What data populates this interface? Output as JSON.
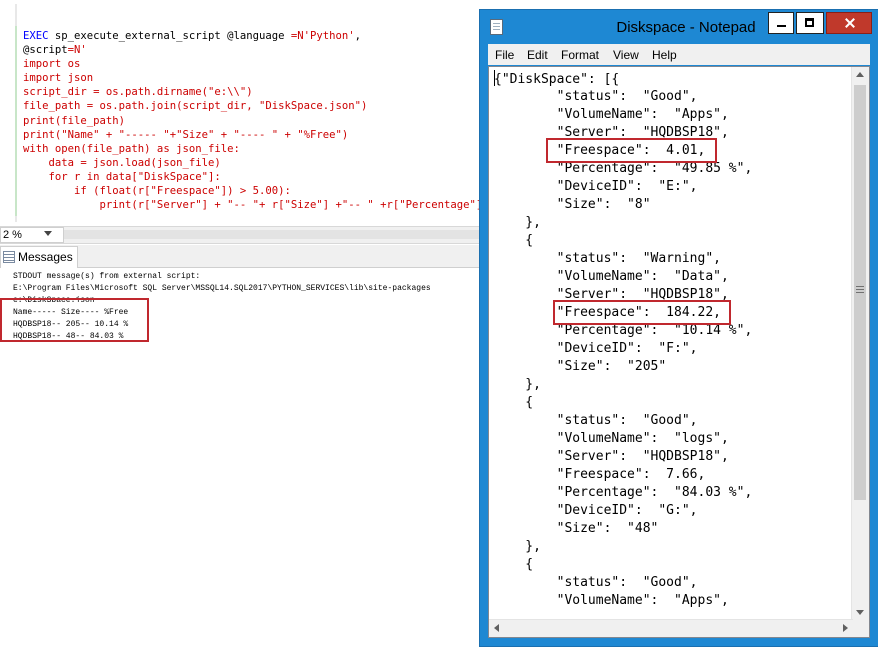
{
  "editor": {
    "code_lines": [
      [
        {
          "t": "EXEC",
          "c": "kw"
        },
        {
          "t": " sp_execute_external_script @language ",
          "c": "pl"
        },
        {
          "t": "=N'Python'",
          "c": "str"
        },
        {
          "t": ",",
          "c": "pl"
        }
      ],
      [
        {
          "t": "@script",
          "c": "pl"
        },
        {
          "t": "=N'",
          "c": "str"
        }
      ],
      [
        {
          "t": "import os",
          "c": "str"
        }
      ],
      [
        {
          "t": "import json",
          "c": "str"
        }
      ],
      [
        {
          "t": "script_dir = os.path.dirname(\"e:\\\\\")",
          "c": "str"
        }
      ],
      [
        {
          "t": "file_path = os.path.join(script_dir, \"DiskSpace.json\")",
          "c": "str"
        }
      ],
      [
        {
          "t": "print(file_path)",
          "c": "str"
        }
      ],
      [
        {
          "t": "print(\"Name\" + \"----- \"+\"Size\" + \"---- \" + \"%Free\")",
          "c": "str"
        }
      ],
      [
        {
          "t": "with open(file_path) as json_file:",
          "c": "str"
        }
      ],
      [
        {
          "t": "    data = json.load(json_file)",
          "c": "str"
        }
      ],
      [
        {
          "t": "    for r in data[\"DiskSpace\"]:",
          "c": "str"
        }
      ],
      [
        {
          "t": "        if (float(r[\"Freespace\"]) > 5.00):",
          "c": "str"
        }
      ],
      [
        {
          "t": "            print(r[\"Server\"] + \"-- \"+ r[\"Size\"] +\"-- \" +r[\"Percentage\"])'",
          "c": "str"
        }
      ]
    ],
    "zoom": "2 %"
  },
  "messages": {
    "tab_label": "Messages",
    "lines": [
      "STDOUT message(s) from external script:",
      "E:\\Program Files\\Microsoft SQL Server\\MSSQL14.SQL2017\\PYTHON_SERVICES\\lib\\site-packages",
      "e:\\DiskSpace.json",
      "Name----- Size---- %Free",
      "HQDBSP18-- 205-- 10.14 %",
      "HQDBSP18-- 48-- 84.03 %"
    ]
  },
  "notepad": {
    "title": "Diskspace - Notepad",
    "menu": [
      "File",
      "Edit",
      "Format",
      "View",
      "Help"
    ],
    "lines": [
      "{\"DiskSpace\": [{",
      "        \"status\":  \"Good\",",
      "        \"VolumeName\":  \"Apps\",",
      "        \"Server\":  \"HQDBSP18\",",
      "        \"Freespace\":  4.01,",
      "        \"Percentage\":  \"49.85 %\",",
      "        \"DeviceID\":  \"E:\",",
      "        \"Size\":  \"8\"",
      "    },",
      "    {",
      "        \"status\":  \"Warning\",",
      "        \"VolumeName\":  \"Data\",",
      "        \"Server\":  \"HQDBSP18\",",
      "        \"Freespace\":  184.22,",
      "        \"Percentage\":  \"10.14 %\",",
      "        \"DeviceID\":  \"F:\",",
      "        \"Size\":  \"205\"",
      "    },",
      "    {",
      "        \"status\":  \"Good\",",
      "        \"VolumeName\":  \"logs\",",
      "        \"Server\":  \"HQDBSP18\",",
      "        \"Freespace\":  7.66,",
      "        \"Percentage\":  \"84.03 %\",",
      "        \"DeviceID\":  \"G:\",",
      "        \"Size\":  \"48\"",
      "    },",
      "    {",
      "        \"status\":  \"Good\",",
      "        \"VolumeName\":  \"Apps\","
    ]
  },
  "colors": {
    "highlight_box": "#c0282e",
    "keyword": "#0000ff",
    "string": "#cc0000",
    "notepad_frame": "#1e88d3",
    "close_button": "#c0392b"
  }
}
